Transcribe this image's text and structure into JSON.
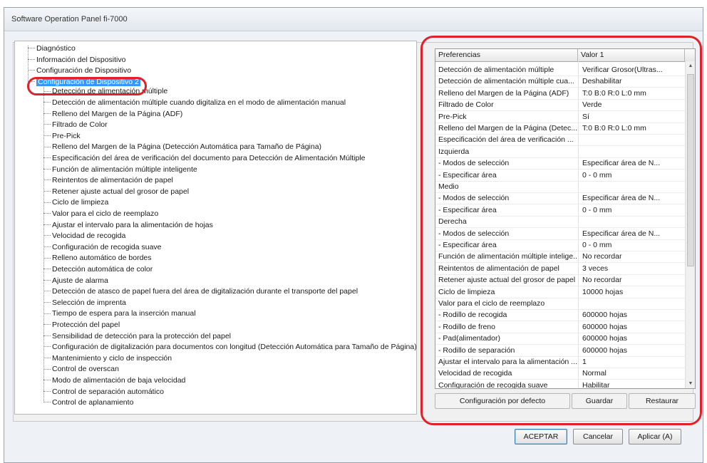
{
  "window": {
    "title": "Software Operation Panel fi-7000"
  },
  "tree": {
    "top_items": [
      "Diagnóstico",
      "Información del Dispositivo",
      "Configuración de Dispositivo",
      "Configuración de Dispositivo 2"
    ],
    "selected_index": 3,
    "child_items": [
      "Detección de alimentación múltiple",
      "Detección de alimentación múltiple cuando digitaliza en el modo de alimentación manual",
      "Relleno del Margen de la Página (ADF)",
      "Filtrado de Color",
      "Pre-Pick",
      "Relleno del Margen de la Página (Detección Automática para Tamaño de Página)",
      "Especificación del área de verificación del documento para Detección de Alimentación Múltiple",
      "Función de alimentación múltiple inteligente",
      "Reintentos de alimentación de papel",
      "Retener ajuste actual del grosor de papel",
      "Ciclo de limpieza",
      "Valor para el ciclo de reemplazo",
      "Ajustar el intervalo para la alimentación de hojas",
      "Velocidad de recogida",
      "Configuración de recogida suave",
      "Relleno automático de bordes",
      "Detección automática de color",
      "Ajuste de alarma",
      "Detección de atasco de papel fuera del área de digitalización durante el transporte del papel",
      "Selección de imprenta",
      "Tiempo de espera para la inserción manual",
      "Protección del papel",
      "Sensibilidad de detección para la protección del papel",
      "Configuración de digitalización para documentos con longitud (Detección Automática para Tamaño de Página)",
      "Mantenimiento y ciclo de inspección",
      "Control de overscan",
      "Modo de alimentación de baja velocidad",
      "Control de separación automático",
      "Control de aplanamiento"
    ]
  },
  "grid": {
    "headers": [
      "Preferencias",
      "Valor 1"
    ],
    "rows": [
      [
        "Detección de alimentación múltiple",
        "Verificar Grosor(Ultras..."
      ],
      [
        "Detección de alimentación múltiple cua...",
        "Deshabilitar"
      ],
      [
        "Relleno del Margen de la Página (ADF)",
        "T:0  B:0  R:0  L:0 mm"
      ],
      [
        "Filtrado de Color",
        "Verde"
      ],
      [
        "Pre-Pick",
        "Sí"
      ],
      [
        "Relleno del Margen de la Página (Detec...",
        "T:0  B:0  R:0  L:0 mm"
      ],
      [
        "Especificación del área de verificación ...",
        ""
      ],
      [
        "Izquierda",
        ""
      ],
      [
        "- Modos de selección",
        "Especificar área de N..."
      ],
      [
        "- Especificar área",
        "0 - 0 mm"
      ],
      [
        "Medio",
        ""
      ],
      [
        "- Modos de selección",
        "Especificar área de N..."
      ],
      [
        "- Especificar área",
        "0 - 0 mm"
      ],
      [
        "Derecha",
        ""
      ],
      [
        "- Modos de selección",
        "Especificar área de N..."
      ],
      [
        "- Especificar área",
        "0 - 0 mm"
      ],
      [
        "Función de alimentación múltiple intelige...",
        "No recordar"
      ],
      [
        "Reintentos de alimentación de papel",
        "3 veces"
      ],
      [
        "Retener ajuste actual del grosor de papel",
        "No recordar"
      ],
      [
        "Ciclo de limpieza",
        "10000 hojas"
      ],
      [
        "Valor para el ciclo de reemplazo",
        ""
      ],
      [
        "- Rodillo de recogida",
        "600000 hojas"
      ],
      [
        "- Rodillo de freno",
        "600000 hojas"
      ],
      [
        "- Pad(alimentador)",
        "600000 hojas"
      ],
      [
        "- Rodillo de separación",
        "600000 hojas"
      ],
      [
        "Ajustar el intervalo para la alimentación ...",
        "1"
      ],
      [
        "Velocidad de recogida",
        "Normal"
      ],
      [
        "Configuración de recogida suave",
        "Habilitar"
      ]
    ],
    "scroll_up": "▲",
    "scroll_down": "▼"
  },
  "grid_buttons": {
    "defaults": "Configuración por defecto",
    "save": "Guardar",
    "restore": "Restaurar"
  },
  "dialog_buttons": {
    "ok": "ACEPTAR",
    "cancel": "Cancelar",
    "apply": "Aplicar (A)"
  },
  "colors": {
    "highlight": "#e0212b",
    "selection": "#3399ff"
  }
}
